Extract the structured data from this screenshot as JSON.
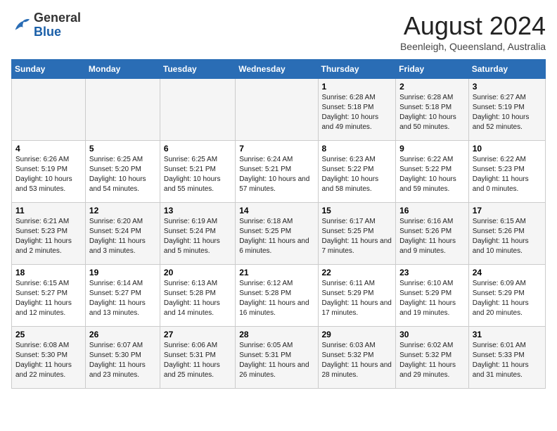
{
  "header": {
    "logo_general": "General",
    "logo_blue": "Blue",
    "month_year": "August 2024",
    "location": "Beenleigh, Queensland, Australia"
  },
  "weekdays": [
    "Sunday",
    "Monday",
    "Tuesday",
    "Wednesday",
    "Thursday",
    "Friday",
    "Saturday"
  ],
  "weeks": [
    [
      {
        "day": "",
        "sunrise": "",
        "sunset": "",
        "daylight": ""
      },
      {
        "day": "",
        "sunrise": "",
        "sunset": "",
        "daylight": ""
      },
      {
        "day": "",
        "sunrise": "",
        "sunset": "",
        "daylight": ""
      },
      {
        "day": "",
        "sunrise": "",
        "sunset": "",
        "daylight": ""
      },
      {
        "day": "1",
        "sunrise": "Sunrise: 6:28 AM",
        "sunset": "Sunset: 5:18 PM",
        "daylight": "Daylight: 10 hours and 49 minutes."
      },
      {
        "day": "2",
        "sunrise": "Sunrise: 6:28 AM",
        "sunset": "Sunset: 5:18 PM",
        "daylight": "Daylight: 10 hours and 50 minutes."
      },
      {
        "day": "3",
        "sunrise": "Sunrise: 6:27 AM",
        "sunset": "Sunset: 5:19 PM",
        "daylight": "Daylight: 10 hours and 52 minutes."
      }
    ],
    [
      {
        "day": "4",
        "sunrise": "Sunrise: 6:26 AM",
        "sunset": "Sunset: 5:19 PM",
        "daylight": "Daylight: 10 hours and 53 minutes."
      },
      {
        "day": "5",
        "sunrise": "Sunrise: 6:25 AM",
        "sunset": "Sunset: 5:20 PM",
        "daylight": "Daylight: 10 hours and 54 minutes."
      },
      {
        "day": "6",
        "sunrise": "Sunrise: 6:25 AM",
        "sunset": "Sunset: 5:21 PM",
        "daylight": "Daylight: 10 hours and 55 minutes."
      },
      {
        "day": "7",
        "sunrise": "Sunrise: 6:24 AM",
        "sunset": "Sunset: 5:21 PM",
        "daylight": "Daylight: 10 hours and 57 minutes."
      },
      {
        "day": "8",
        "sunrise": "Sunrise: 6:23 AM",
        "sunset": "Sunset: 5:22 PM",
        "daylight": "Daylight: 10 hours and 58 minutes."
      },
      {
        "day": "9",
        "sunrise": "Sunrise: 6:22 AM",
        "sunset": "Sunset: 5:22 PM",
        "daylight": "Daylight: 10 hours and 59 minutes."
      },
      {
        "day": "10",
        "sunrise": "Sunrise: 6:22 AM",
        "sunset": "Sunset: 5:23 PM",
        "daylight": "Daylight: 11 hours and 0 minutes."
      }
    ],
    [
      {
        "day": "11",
        "sunrise": "Sunrise: 6:21 AM",
        "sunset": "Sunset: 5:23 PM",
        "daylight": "Daylight: 11 hours and 2 minutes."
      },
      {
        "day": "12",
        "sunrise": "Sunrise: 6:20 AM",
        "sunset": "Sunset: 5:24 PM",
        "daylight": "Daylight: 11 hours and 3 minutes."
      },
      {
        "day": "13",
        "sunrise": "Sunrise: 6:19 AM",
        "sunset": "Sunset: 5:24 PM",
        "daylight": "Daylight: 11 hours and 5 minutes."
      },
      {
        "day": "14",
        "sunrise": "Sunrise: 6:18 AM",
        "sunset": "Sunset: 5:25 PM",
        "daylight": "Daylight: 11 hours and 6 minutes."
      },
      {
        "day": "15",
        "sunrise": "Sunrise: 6:17 AM",
        "sunset": "Sunset: 5:25 PM",
        "daylight": "Daylight: 11 hours and 7 minutes."
      },
      {
        "day": "16",
        "sunrise": "Sunrise: 6:16 AM",
        "sunset": "Sunset: 5:26 PM",
        "daylight": "Daylight: 11 hours and 9 minutes."
      },
      {
        "day": "17",
        "sunrise": "Sunrise: 6:15 AM",
        "sunset": "Sunset: 5:26 PM",
        "daylight": "Daylight: 11 hours and 10 minutes."
      }
    ],
    [
      {
        "day": "18",
        "sunrise": "Sunrise: 6:15 AM",
        "sunset": "Sunset: 5:27 PM",
        "daylight": "Daylight: 11 hours and 12 minutes."
      },
      {
        "day": "19",
        "sunrise": "Sunrise: 6:14 AM",
        "sunset": "Sunset: 5:27 PM",
        "daylight": "Daylight: 11 hours and 13 minutes."
      },
      {
        "day": "20",
        "sunrise": "Sunrise: 6:13 AM",
        "sunset": "Sunset: 5:28 PM",
        "daylight": "Daylight: 11 hours and 14 minutes."
      },
      {
        "day": "21",
        "sunrise": "Sunrise: 6:12 AM",
        "sunset": "Sunset: 5:28 PM",
        "daylight": "Daylight: 11 hours and 16 minutes."
      },
      {
        "day": "22",
        "sunrise": "Sunrise: 6:11 AM",
        "sunset": "Sunset: 5:29 PM",
        "daylight": "Daylight: 11 hours and 17 minutes."
      },
      {
        "day": "23",
        "sunrise": "Sunrise: 6:10 AM",
        "sunset": "Sunset: 5:29 PM",
        "daylight": "Daylight: 11 hours and 19 minutes."
      },
      {
        "day": "24",
        "sunrise": "Sunrise: 6:09 AM",
        "sunset": "Sunset: 5:29 PM",
        "daylight": "Daylight: 11 hours and 20 minutes."
      }
    ],
    [
      {
        "day": "25",
        "sunrise": "Sunrise: 6:08 AM",
        "sunset": "Sunset: 5:30 PM",
        "daylight": "Daylight: 11 hours and 22 minutes."
      },
      {
        "day": "26",
        "sunrise": "Sunrise: 6:07 AM",
        "sunset": "Sunset: 5:30 PM",
        "daylight": "Daylight: 11 hours and 23 minutes."
      },
      {
        "day": "27",
        "sunrise": "Sunrise: 6:06 AM",
        "sunset": "Sunset: 5:31 PM",
        "daylight": "Daylight: 11 hours and 25 minutes."
      },
      {
        "day": "28",
        "sunrise": "Sunrise: 6:05 AM",
        "sunset": "Sunset: 5:31 PM",
        "daylight": "Daylight: 11 hours and 26 minutes."
      },
      {
        "day": "29",
        "sunrise": "Sunrise: 6:03 AM",
        "sunset": "Sunset: 5:32 PM",
        "daylight": "Daylight: 11 hours and 28 minutes."
      },
      {
        "day": "30",
        "sunrise": "Sunrise: 6:02 AM",
        "sunset": "Sunset: 5:32 PM",
        "daylight": "Daylight: 11 hours and 29 minutes."
      },
      {
        "day": "31",
        "sunrise": "Sunrise: 6:01 AM",
        "sunset": "Sunset: 5:33 PM",
        "daylight": "Daylight: 11 hours and 31 minutes."
      }
    ]
  ]
}
